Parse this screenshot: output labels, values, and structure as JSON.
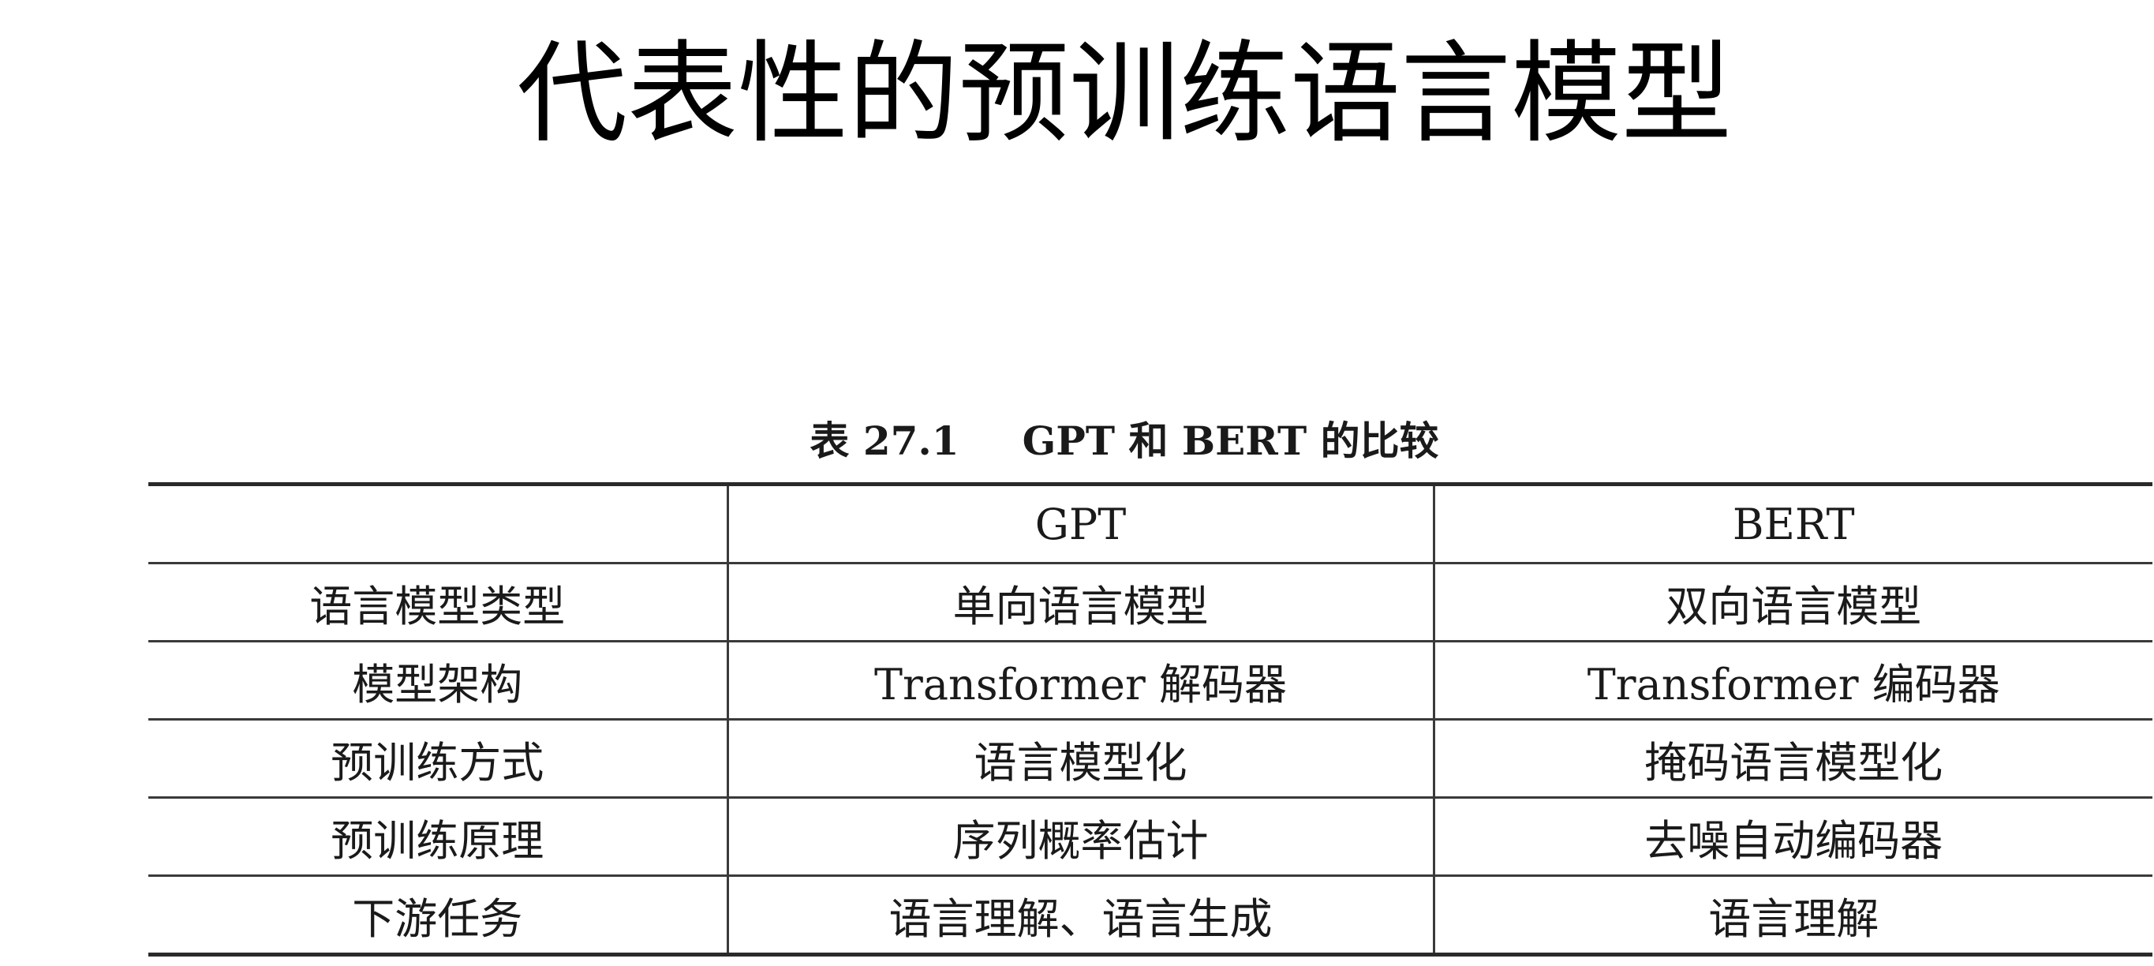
{
  "slide": {
    "title": "代表性的预训练语言模型"
  },
  "table": {
    "caption_number": "表 27.1",
    "caption_text": "GPT 和 BERT 的比较",
    "headers": [
      "",
      "GPT",
      "BERT"
    ],
    "rows": [
      [
        "语言模型类型",
        "单向语言模型",
        "双向语言模型"
      ],
      [
        "模型架构",
        "Transformer 解码器",
        "Transformer 编码器"
      ],
      [
        "预训练方式",
        "语言模型化",
        "掩码语言模型化"
      ],
      [
        "预训练原理",
        "序列概率估计",
        "去噪自动编码器"
      ],
      [
        "下游任务",
        "语言理解、语言生成",
        "语言理解"
      ]
    ]
  }
}
